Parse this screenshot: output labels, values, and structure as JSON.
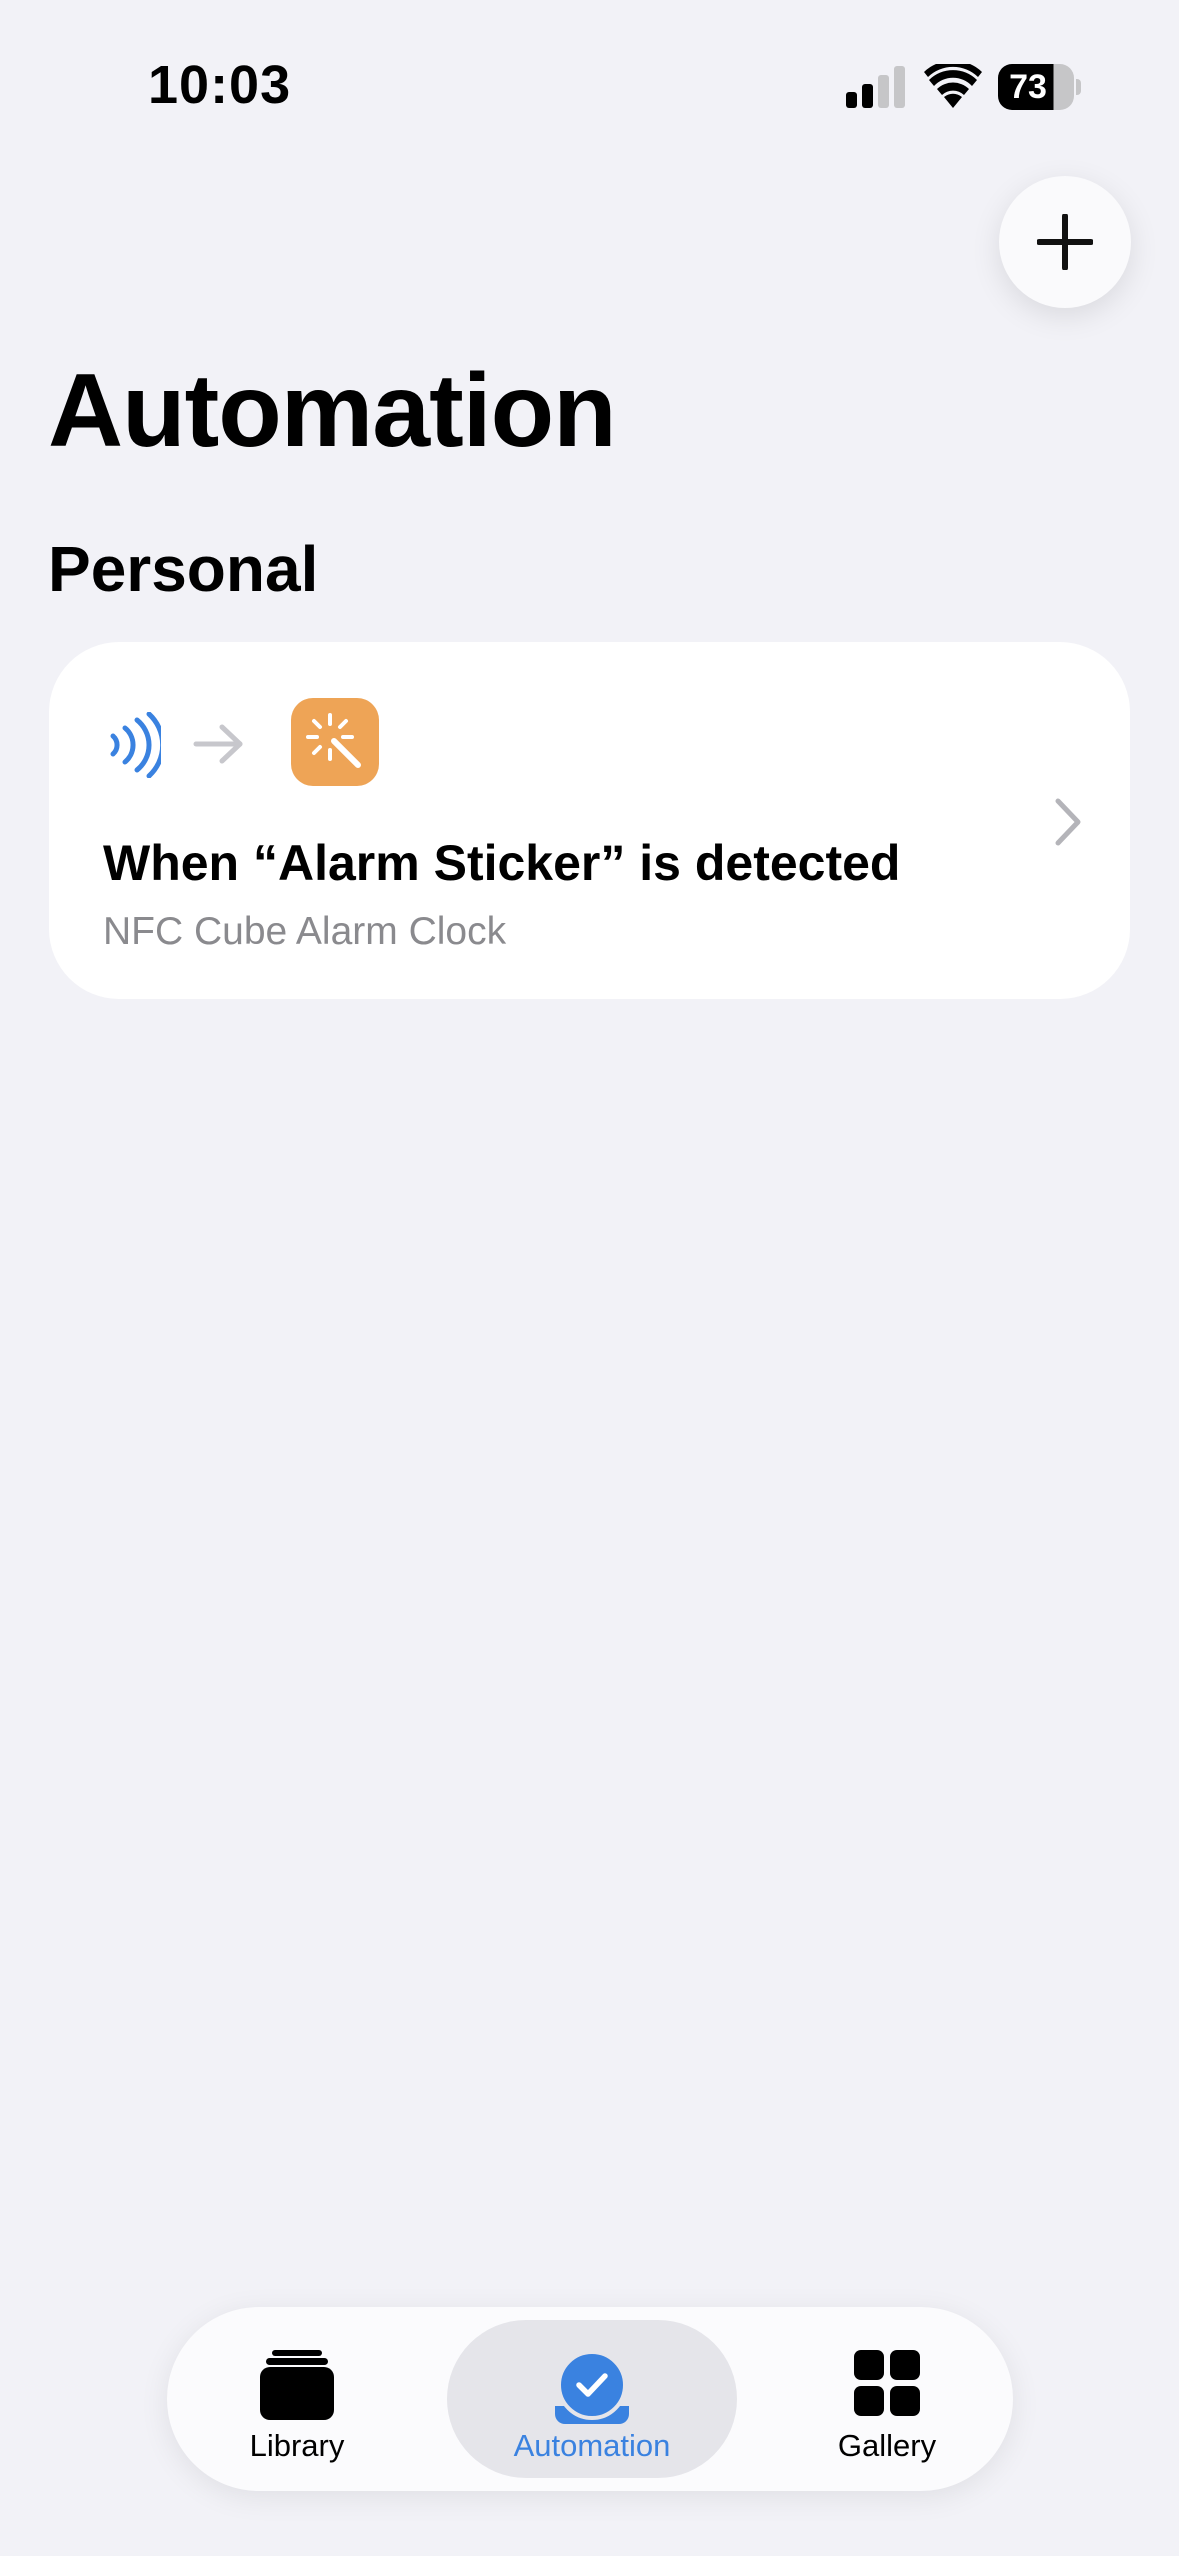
{
  "status_bar": {
    "time": "10:03",
    "battery_level": "73",
    "icons": [
      "signal-icon",
      "wifi-icon",
      "battery-icon"
    ]
  },
  "header": {
    "title": "Automation",
    "add_icon": "plus-icon"
  },
  "section": {
    "title": "Personal"
  },
  "automation_card": {
    "trigger_icon": "nfc-icon",
    "action_icon": "magic-wand-icon",
    "title": "When “Alarm Sticker” is detected",
    "subtitle": "NFC Cube Alarm Clock"
  },
  "tab_bar": {
    "active_tab": "Automation",
    "tabs": [
      {
        "label": "Library",
        "icon": "library-stack-icon"
      },
      {
        "label": "Automation",
        "icon": "automation-check-icon"
      },
      {
        "label": "Gallery",
        "icon": "gallery-grid-icon"
      }
    ]
  },
  "colors": {
    "background": "#f2f2f7",
    "accent": "#3a82e0",
    "action_orange": "#eea456",
    "secondary_text": "#8a8a8e"
  }
}
